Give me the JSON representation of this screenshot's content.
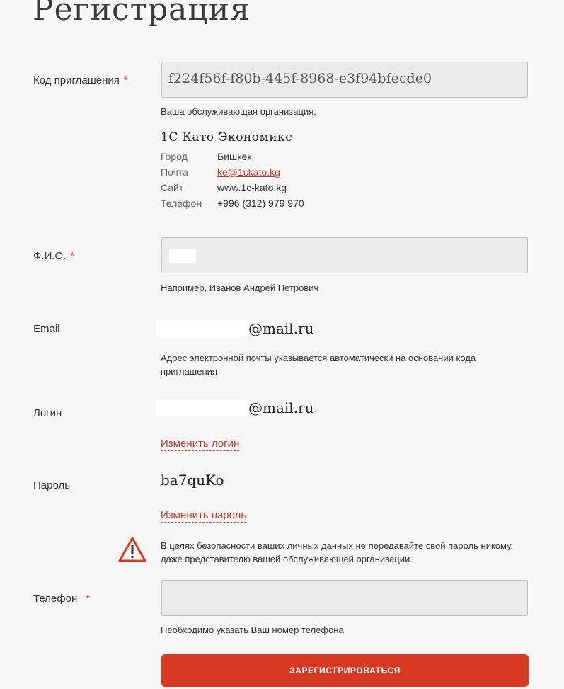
{
  "page": {
    "title": "Регистрация"
  },
  "invite": {
    "label": "Код приглашения",
    "required_mark": "*",
    "value": "f224f56f-f80b-445f-8968-e3f94bfecde0"
  },
  "organization": {
    "caption": "Ваша обслуживающая организация:",
    "name": "1С Като Экономикс",
    "city_label": "Город",
    "city": "Бишкек",
    "email_label": "Почта",
    "email": "ke@1ckato.kg",
    "site_label": "Сайт",
    "site": "www.1c-kato.kg",
    "phone_label": "Телефон",
    "phone": "+996 (312) 979 970"
  },
  "fio": {
    "label": "Ф.И.О.",
    "required_mark": "*",
    "hint": "Например, Иванов Андрей Петрович"
  },
  "email": {
    "label": "Email",
    "value_suffix": "@mail.ru",
    "hint": "Адрес электронной почты указывается автоматически на основании кода приглашения"
  },
  "login": {
    "label": "Логин",
    "value_suffix": "@mail.ru",
    "change_link": "Изменить логин"
  },
  "password": {
    "label": "Пароль",
    "value": "ba7quKo",
    "change_link": "Изменить пароль"
  },
  "warning": {
    "icon": "warning-triangle-icon",
    "text": "В целях безопасности ваших личных данных не передавайте свой пароль никому, даже представителю вашей обслуживающей организации."
  },
  "phone": {
    "label": "Телефон",
    "required_mark": "*",
    "hint": "Необходимо указать Ваш номер телефона"
  },
  "submit": {
    "label": "ЗАРЕГИСТРИРОВАТЬСЯ"
  },
  "colors": {
    "accent": "#d73a22",
    "link": "#c0392b",
    "field_bg": "#ebebeb",
    "page_bg": "#f6f6f6"
  }
}
